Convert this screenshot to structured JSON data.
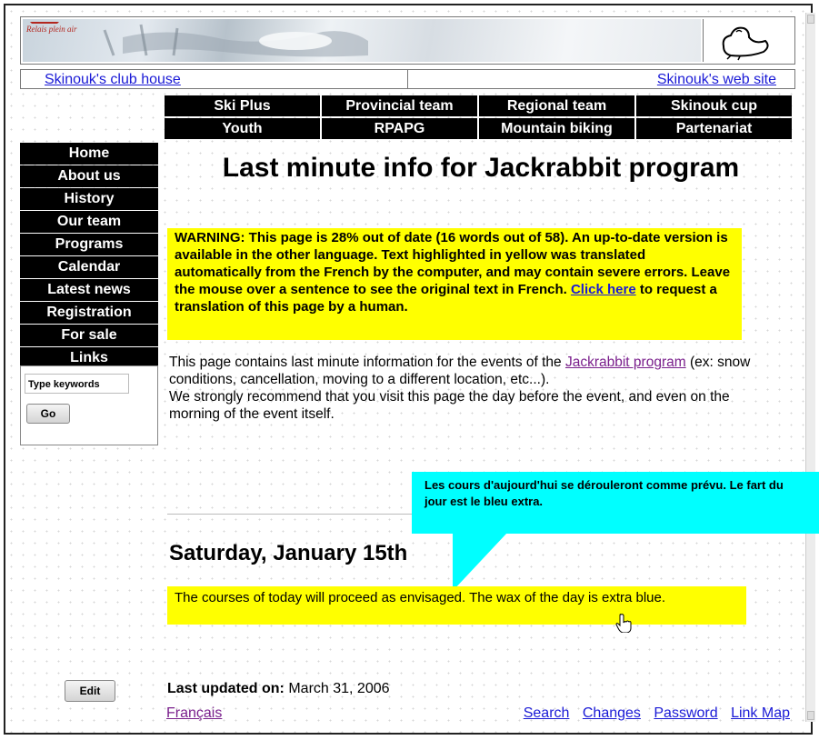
{
  "header": {
    "logo_text": "Relais plein air"
  },
  "linkbar": {
    "left": "Skinouk's club house",
    "right": "Skinouk's web site"
  },
  "topnav": [
    "Ski Plus",
    "Provincial team",
    "Regional team",
    "Skinouk cup",
    "Youth",
    "RPAPG",
    "Mountain biking",
    "Partenariat"
  ],
  "sidenav": [
    "Home",
    "About us",
    "History",
    "Our team",
    "Programs",
    "Calendar",
    "Latest news",
    "Registration",
    "For sale",
    "Links"
  ],
  "search": {
    "placeholder": "Type keywords",
    "button": "Go"
  },
  "page": {
    "title": "Last minute info for Jackrabbit program",
    "warning_before": "WARNING: This page is 28% out of date (16 words out of 58). An up-to-date version is available in the other language. Text highlighted in yellow was translated automatically from the French by the computer, and may contain severe errors. Leave the mouse over a sentence to see the original text in French. ",
    "warning_link": "Click here",
    "warning_after": " to request a translation of this page by a human.",
    "intro_before": "This page contains last minute information for the events of the ",
    "intro_link": "Jackrabbit program",
    "intro_after": " (ex: snow conditions, cancellation, moving to a different location, etc...).",
    "recommend": "We strongly recommend that you visit this page the day before the event, and even on the morning of the event itself.",
    "tooltip": "Les cours d'aujourd'hui se dérouleront comme prévu. Le fart du jour est le bleu extra.",
    "date_heading": "Saturday, January 15th",
    "translated": "The courses of today will proceed as envisaged. The wax of the day is extra blue."
  },
  "footer": {
    "edit": "Edit",
    "updated_label": "Last updated on:",
    "updated_value": " March 31, 2006",
    "lang_link": "Français",
    "links": [
      "Search",
      "Changes",
      "Password",
      "Link Map"
    ]
  }
}
